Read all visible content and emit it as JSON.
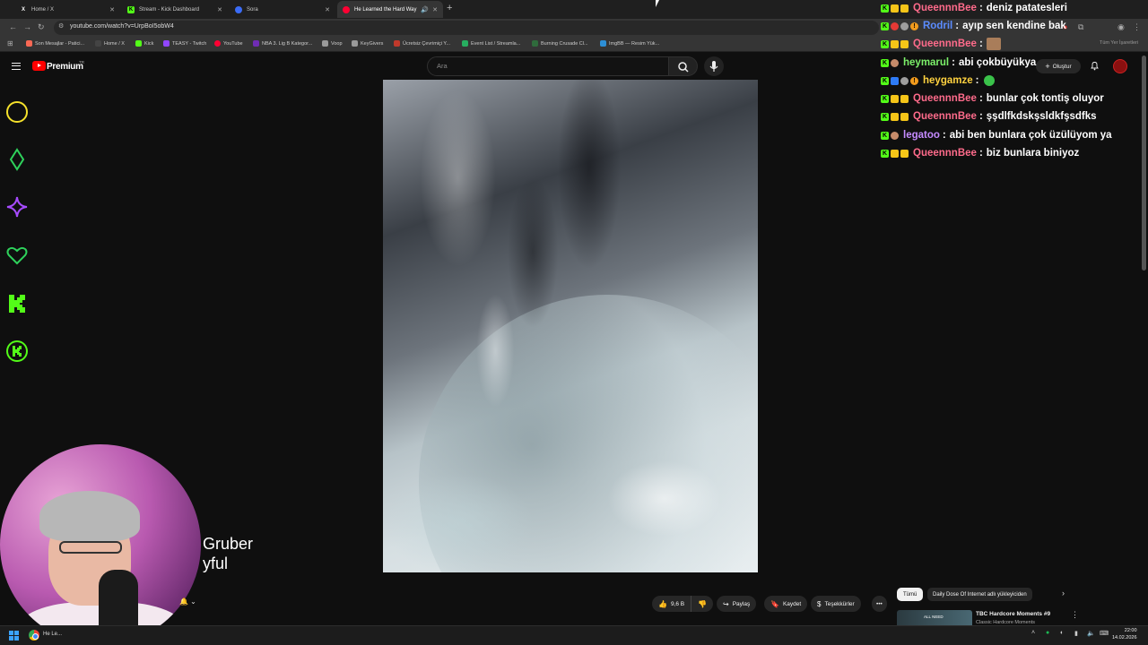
{
  "browser": {
    "tabs": [
      {
        "label": "Home / X",
        "icon": "x-logo-icon"
      },
      {
        "label": "Stream - Kick Dashboard",
        "icon": "kick-logo-icon"
      },
      {
        "label": "Sora",
        "icon": "sora-logo-icon"
      },
      {
        "label": "He Learned the Hard Way",
        "icon": "youtube-logo-icon"
      }
    ],
    "url": "youtube.com/watch?v=UrpBoI5obW4",
    "bookmarks": [
      "Son Mesajlar - Patici...",
      "Home / X",
      "Kick",
      "TEASY - Twitch",
      "YouTube",
      "NBA 3. Lig B Kategor...",
      "Voop",
      "KeyGivers",
      "Ücretsiz Çevrimiçi Y...",
      "Event List / Streamla...",
      "Burning Crusade Cl...",
      "ImgBB — Resim Yük..."
    ],
    "bookmarks_right": "Tüm Yer İşaretleri"
  },
  "youtube": {
    "brand": "Premium",
    "region": "TR",
    "search_placeholder": "Ara",
    "create_label": "Oluştur"
  },
  "overlay_name": {
    "line1": "Gruber",
    "line2": "yful"
  },
  "chat": [
    {
      "user": "QueennnBee",
      "color": "#ff6b8b",
      "text": "deniz patatesleri",
      "badges": [
        "k",
        "crown",
        "crown"
      ]
    },
    {
      "user": "Rodril",
      "color": "#5b8cff",
      "text": "ayıp sen kendine bak",
      "badges": [
        "k",
        "red",
        "gray",
        "orange"
      ]
    },
    {
      "user": "QueennnBee",
      "color": "#ff6b8b",
      "text": "",
      "badges": [
        "k",
        "crown",
        "crown"
      ],
      "emote": "image-emote"
    },
    {
      "user": "heymarul",
      "color": "#7cf06a",
      "text": "abi çokbüyükya",
      "badges": [
        "k",
        "face"
      ]
    },
    {
      "user": "heygamze",
      "color": "#ffd23f",
      "text": "",
      "badges": [
        "k",
        "blue",
        "gray",
        "orange"
      ],
      "emote": "green-emote"
    },
    {
      "user": "QueennnBee",
      "color": "#ff6b8b",
      "text": "bunlar çok tontiş oluyor",
      "badges": [
        "k",
        "crown",
        "crown"
      ]
    },
    {
      "user": "QueennnBee",
      "color": "#ff6b8b",
      "text": "şşdlfkdskşsldkfşsdfks",
      "badges": [
        "k",
        "crown",
        "crown"
      ]
    },
    {
      "user": "legatoo",
      "color": "#c58bff",
      "text": "abi ben bunlara çok üzülüyom ya",
      "badges": [
        "k",
        "face"
      ]
    },
    {
      "user": "QueennnBee",
      "color": "#ff6b8b",
      "text": "biz bunlara biniyoz",
      "badges": [
        "k",
        "crown",
        "crown"
      ]
    }
  ],
  "actions": {
    "likes": "9,6 B",
    "share": "Paylaş",
    "save": "Kaydet",
    "thanks": "Teşekkürler"
  },
  "recommendations": {
    "chip_all": "Tümü",
    "chip_channel": "Daily Dose Of Internet adlı yükleyiciden",
    "item_title": "TBC Hardcore Moments #9",
    "item_sub": "Classic Hardcore Moments",
    "item_badge": "ALL NEED"
  },
  "taskbar": {
    "app_label": "He Le...",
    "time": "22:00",
    "date": "14.02.2026"
  }
}
